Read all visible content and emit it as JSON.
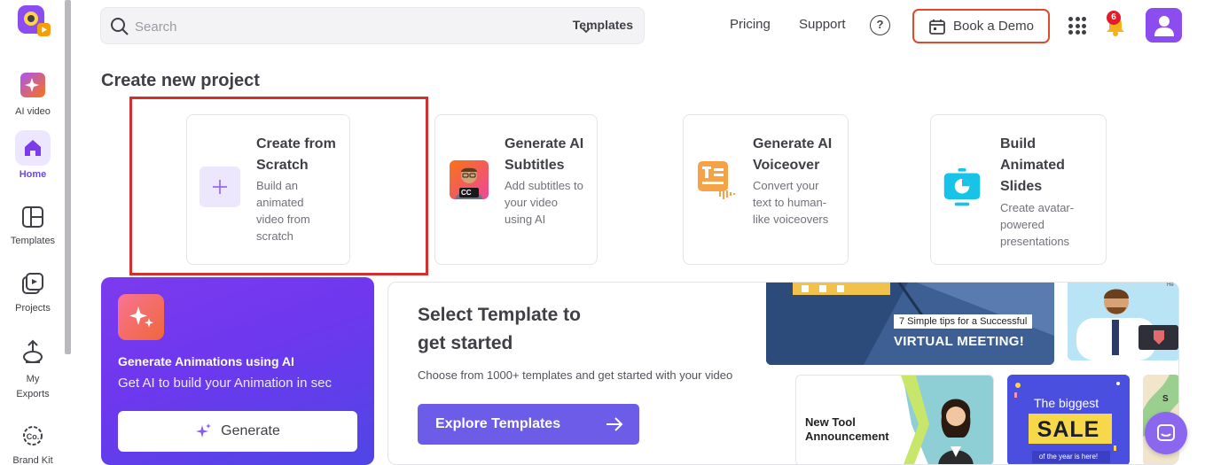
{
  "sidebar": {
    "items": [
      {
        "label": "AI video"
      },
      {
        "label": "Home"
      },
      {
        "label": "Templates"
      },
      {
        "label": "Projects"
      },
      {
        "label": "My Exports"
      },
      {
        "label": "Brand Kit"
      }
    ]
  },
  "topbar": {
    "search_placeholder": "Search",
    "templates_dropdown": "Templates",
    "pricing": "Pricing",
    "support": "Support",
    "help": "?",
    "book_demo": "Book a Demo",
    "notification_count": "6"
  },
  "main": {
    "section_title": "Create new project",
    "cards": [
      {
        "title": "Create from Scratch",
        "desc": "Build an animated video from scratch"
      },
      {
        "title": "Generate AI Subtitles",
        "desc": "Add subtitles to your video using AI"
      },
      {
        "title": "Generate AI Voiceover",
        "desc": "Convert your text to human-like voiceovers"
      },
      {
        "title": "Build Animated Slides",
        "desc": "Create avatar-powered presentations"
      }
    ],
    "cc_badge": "CC"
  },
  "ai_panel": {
    "title": "Generate Animations using AI",
    "subtitle": "Get AI to build your Animation in sec",
    "button": "Generate"
  },
  "template_panel": {
    "title": "Select Template to get started",
    "subtitle": "Choose from 1000+ templates and get started with your video",
    "button": "Explore Templates",
    "thumb_meeting_line1": "7 Simple tips for a Successful",
    "thumb_meeting_line2": "VIRTUAL MEETING!",
    "thumb_tool": "New Tool Announcement",
    "thumb_sale_top": "The biggest",
    "thumb_sale_mid": "SALE",
    "thumb_sale_bottom": "of the year is here!"
  },
  "colors": {
    "accent": "#6d48e5",
    "highlight": "#d32f2f",
    "demo_border": "#e04a2a",
    "explore_button": "#6c5ce7"
  }
}
